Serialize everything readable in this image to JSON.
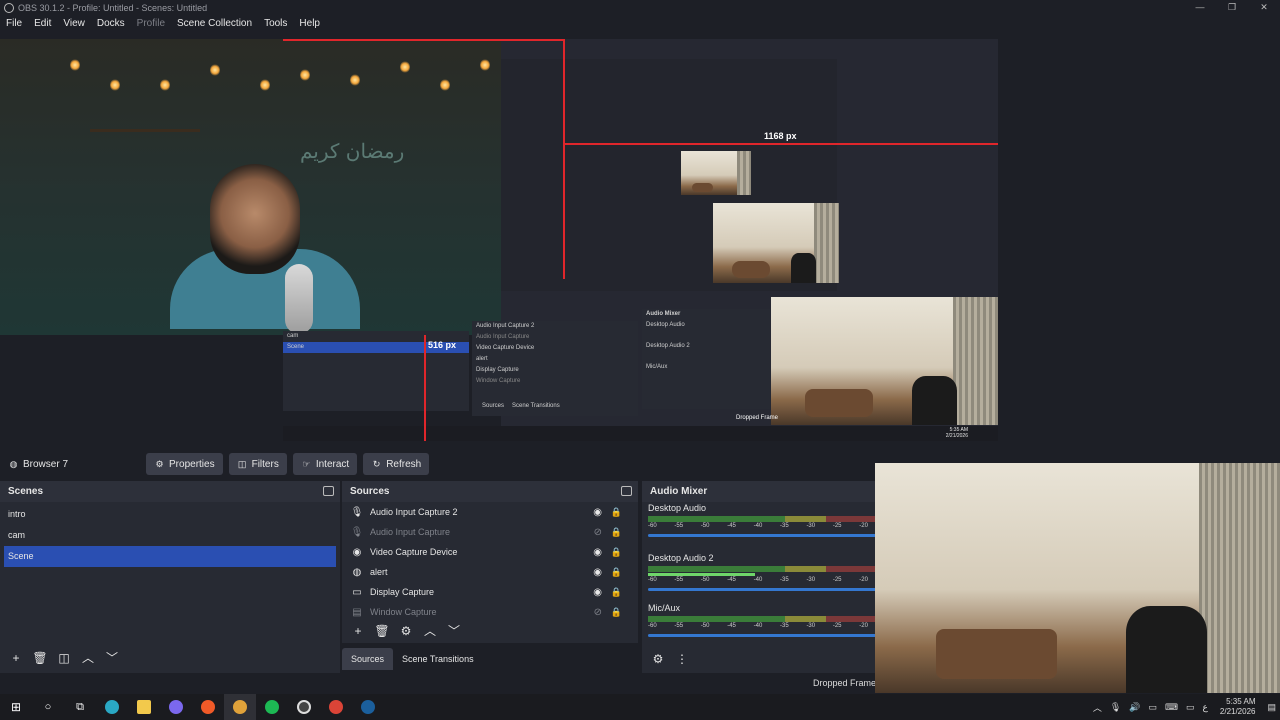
{
  "window": {
    "title": "OBS 30.1.2 - Profile: Untitled - Scenes: Untitled",
    "controls": [
      "—",
      "❐",
      "✕"
    ]
  },
  "menu": {
    "items": [
      {
        "label": "File",
        "enabled": true
      },
      {
        "label": "Edit",
        "enabled": true
      },
      {
        "label": "View",
        "enabled": true
      },
      {
        "label": "Docks",
        "enabled": true
      },
      {
        "label": "Profile",
        "enabled": false
      },
      {
        "label": "Scene Collection",
        "enabled": true
      },
      {
        "label": "Tools",
        "enabled": true
      },
      {
        "label": "Help",
        "enabled": true
      }
    ]
  },
  "preview": {
    "cam_text": "رمضان كريم",
    "label_width": "1168 px",
    "label_height": "516 px",
    "mini_scenes": [
      "cam",
      "Scene"
    ],
    "mini_sources": [
      "Audio Input Capture 2",
      "Audio Input Capture",
      "Video Capture Device",
      "alert",
      "Display Capture",
      "Window Capture"
    ],
    "mini_mixer": [
      "Audio Mixer",
      "Desktop Audio",
      "Desktop Audio 2",
      "Mic/Aux"
    ],
    "mini_tabs": [
      "Sources",
      "Scene Transitions"
    ],
    "mini_dropped": "Dropped Frame",
    "mini_clock": [
      "5:35 AM",
      "2/21/2026"
    ]
  },
  "toolbar": {
    "source_name": "Browser 7",
    "properties": "Properties",
    "filters": "Filters",
    "interact": "Interact",
    "refresh": "Refresh"
  },
  "scenes": {
    "title": "Scenes",
    "items": [
      {
        "label": "intro",
        "selected": false
      },
      {
        "label": "cam",
        "selected": false
      },
      {
        "label": "Scene",
        "selected": true
      }
    ]
  },
  "sources": {
    "title": "Sources",
    "items": [
      {
        "label": "Audio Input Capture 2",
        "icon": "microphone-icon",
        "glyph": "🎙",
        "visible": true
      },
      {
        "label": "Audio Input Capture",
        "icon": "microphone-icon",
        "glyph": "🎙",
        "visible": false
      },
      {
        "label": "Video Capture Device",
        "icon": "camera-icon",
        "glyph": "◉",
        "visible": true
      },
      {
        "label": "alert",
        "icon": "globe-icon",
        "glyph": "◍",
        "visible": true
      },
      {
        "label": "Display Capture",
        "icon": "monitor-icon",
        "glyph": "▭",
        "visible": true
      },
      {
        "label": "Window Capture",
        "icon": "window-icon",
        "glyph": "▤",
        "visible": false
      }
    ]
  },
  "tabs": {
    "sources": "Sources",
    "transitions": "Scene Transitions"
  },
  "mixer": {
    "title": "Audio Mixer",
    "scale": [
      "-60",
      "-55",
      "-50",
      "-45",
      "-40",
      "-35",
      "-30",
      "-25",
      "-20"
    ],
    "channels": [
      {
        "name": "Desktop Audio",
        "level": 0
      },
      {
        "name": "Desktop Audio 2",
        "level": 0.47
      },
      {
        "name": "Mic/Aux",
        "level": 0
      }
    ]
  },
  "status": {
    "dropped_frames": "Dropped Frame"
  },
  "taskbar": {
    "clock_time": "5:35 AM",
    "clock_date": "2/21/2026",
    "lang": "ع",
    "apps": [
      {
        "name": "start-icon",
        "color": "#ffffff"
      },
      {
        "name": "search-icon",
        "color": "#ffffff"
      },
      {
        "name": "task-view-icon",
        "color": "#ffffff"
      },
      {
        "name": "edge-icon",
        "color": "#2aa8c4"
      },
      {
        "name": "folder-icon",
        "color": "#f2c94c"
      },
      {
        "name": "discord-icon",
        "color": "#7b68ee"
      },
      {
        "name": "brave-icon",
        "color": "#f05a28"
      },
      {
        "name": "chrome-active-icon",
        "color": "#e0a23a"
      },
      {
        "name": "spotify-icon",
        "color": "#1db954"
      },
      {
        "name": "obs-icon",
        "color": "#444444"
      },
      {
        "name": "chrome-icon",
        "color": "#db4437"
      },
      {
        "name": "steam-icon",
        "color": "#1b5f9c"
      }
    ]
  }
}
